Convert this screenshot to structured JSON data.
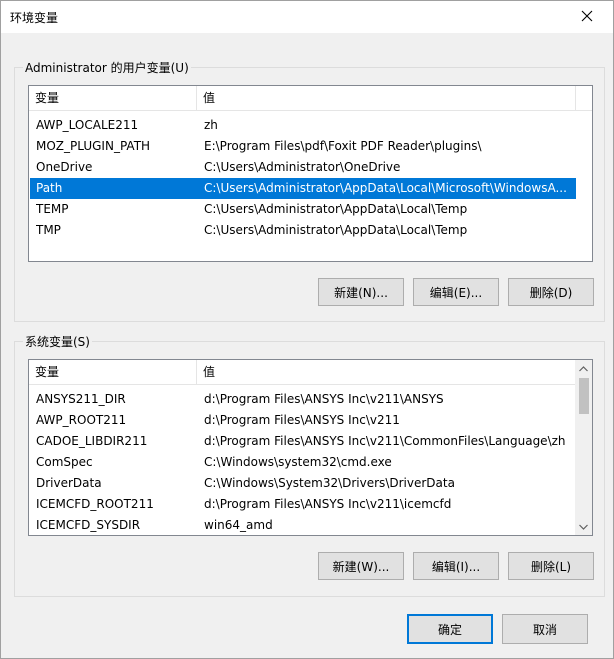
{
  "window": {
    "title": "环境变量"
  },
  "user_vars": {
    "group_label": "Administrator 的用户变量(U)",
    "col_name": "变量",
    "col_value": "值",
    "rows": [
      {
        "name": "AWP_LOCALE211",
        "value": "zh"
      },
      {
        "name": "MOZ_PLUGIN_PATH",
        "value": "E:\\Program Files\\pdf\\Foxit PDF Reader\\plugins\\"
      },
      {
        "name": "OneDrive",
        "value": "C:\\Users\\Administrator\\OneDrive"
      },
      {
        "name": "Path",
        "value": "C:\\Users\\Administrator\\AppData\\Local\\Microsoft\\WindowsA..."
      },
      {
        "name": "TEMP",
        "value": "C:\\Users\\Administrator\\AppData\\Local\\Temp"
      },
      {
        "name": "TMP",
        "value": "C:\\Users\\Administrator\\AppData\\Local\\Temp"
      }
    ],
    "selected_index": 3,
    "new_label": "新建(N)...",
    "edit_label": "编辑(E)...",
    "delete_label": "删除(D)"
  },
  "sys_vars": {
    "group_label": "系统变量(S)",
    "col_name": "变量",
    "col_value": "值",
    "rows": [
      {
        "name": "ANSYS211_DIR",
        "value": "d:\\Program Files\\ANSYS Inc\\v211\\ANSYS"
      },
      {
        "name": "AWP_ROOT211",
        "value": "d:\\Program Files\\ANSYS Inc\\v211"
      },
      {
        "name": "CADOE_LIBDIR211",
        "value": "d:\\Program Files\\ANSYS Inc\\v211\\CommonFiles\\Language\\zh"
      },
      {
        "name": "ComSpec",
        "value": "C:\\Windows\\system32\\cmd.exe"
      },
      {
        "name": "DriverData",
        "value": "C:\\Windows\\System32\\Drivers\\DriverData"
      },
      {
        "name": "ICEMCFD_ROOT211",
        "value": "d:\\Program Files\\ANSYS Inc\\v211\\icemcfd"
      },
      {
        "name": "ICEMCFD_SYSDIR",
        "value": "win64_amd"
      }
    ],
    "new_label": "新建(W)...",
    "edit_label": "编辑(I)...",
    "delete_label": "删除(L)"
  },
  "footer": {
    "ok_label": "确定",
    "cancel_label": "取消"
  },
  "colors": {
    "accent": "#0078d7",
    "window_bg": "#f0f0f0",
    "button_bg": "#e1e1e1"
  },
  "icons": {
    "close": "close-icon",
    "scroll_up": "chevron-up-icon",
    "scroll_down": "chevron-down-icon"
  }
}
